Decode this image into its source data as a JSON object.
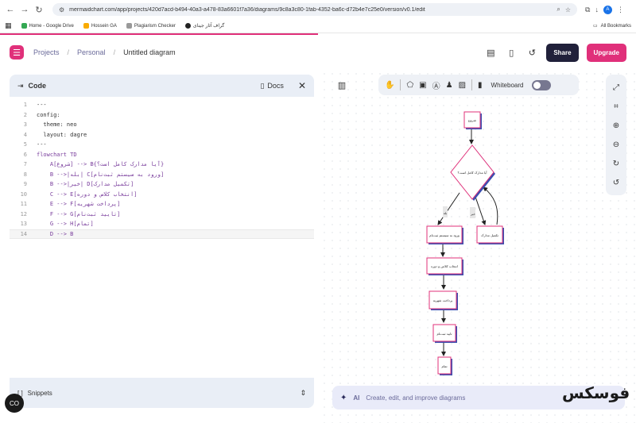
{
  "browser": {
    "url": "mermaidchart.com/app/projects/420d7acd-b494-40a3-a478-83a6601f7a36/diagrams/9c8a3c80-1fab-4352-ba6c-d72b4e7c25e0/version/v0.1/edit",
    "profile_initial": "A",
    "bookmarks": [
      "Home - Google Drive",
      "Hossein GA",
      "Plagiarism Checker",
      "گراف آثار جینای"
    ],
    "all_bookmarks": "All Bookmarks"
  },
  "header": {
    "breadcrumb": [
      "Projects",
      "Personal",
      "Untitled diagram"
    ],
    "share_label": "Share",
    "upgrade_label": "Upgrade"
  },
  "code_panel": {
    "title": "Code",
    "docs_label": "Docs",
    "lines": [
      {
        "n": "1",
        "text": "---"
      },
      {
        "n": "2",
        "text": "config:"
      },
      {
        "n": "3",
        "text": "  theme: neo"
      },
      {
        "n": "4",
        "text": "  layout: dagre"
      },
      {
        "n": "5",
        "text": "---"
      },
      {
        "n": "6",
        "text": "flowchart TD"
      },
      {
        "n": "7",
        "text": "    A[شروع] --> B{آیا مدارک کامل است؟}"
      },
      {
        "n": "8",
        "text": "    B -->|بله| C[ورود به سیستم ثبت‌نام]"
      },
      {
        "n": "9",
        "text": "    B -->|خیر| D[تکمیل مدارک]"
      },
      {
        "n": "10",
        "text": "    C --> E[انتخاب کلاس و دوره]"
      },
      {
        "n": "11",
        "text": "    E --> F[پرداخت شهریه]"
      },
      {
        "n": "12",
        "text": "    F --> G[تایید ثبت‌نام]"
      },
      {
        "n": "13",
        "text": "    G --> H[تمام]"
      },
      {
        "n": "14",
        "text": "    D --> B"
      }
    ],
    "snippets_label": "Snippets"
  },
  "canvas": {
    "whiteboard_label": "Whiteboard"
  },
  "ai_bar": {
    "label": "AI",
    "placeholder": "Create, edit, and improve diagrams"
  },
  "diagram": {
    "nodes": {
      "A": "شروع",
      "B": "آیا مدارک کامل است؟",
      "C": "ورود به سیستم ثبت‌نام",
      "D": "تکمیل مدارک",
      "E": "انتخاب کلاس و دوره",
      "F": "پرداخت شهریه",
      "G": "تایید ثبت‌نام",
      "H": "تمام"
    },
    "edge_labels": {
      "yes": "بله",
      "no": "خیر"
    },
    "node_border_color": "#e0307a",
    "node_shadow_color": "#3b4fb0"
  },
  "watermark": "فوسکس",
  "floating_button": "CO"
}
